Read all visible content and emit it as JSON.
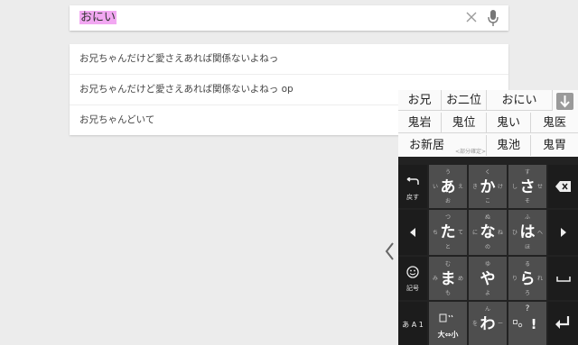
{
  "search": {
    "query": "おにい"
  },
  "suggestions": [
    "お兄ちゃんだけど愛さえあれば関係ないよねっ",
    "お兄ちゃんだけど愛さえあれば関係ないよねっ op",
    "お兄ちゃんどいて"
  ],
  "candidates": {
    "row1": [
      "お兄",
      "お二位",
      "おにい"
    ],
    "row2": [
      "鬼岩",
      "鬼位",
      "鬼い",
      "鬼医"
    ],
    "row3": [
      "お新居",
      "鬼池",
      "鬼胃"
    ],
    "partial_label": "<部分確定>"
  },
  "keyboard": {
    "undo_label": "戻す",
    "kigou_label": "記号",
    "mode_label": "あ A 1",
    "kana": [
      {
        "main": "あ",
        "top": "う",
        "left": "い",
        "right": "え",
        "bottom": "お"
      },
      {
        "main": "か",
        "top": "く",
        "left": "き",
        "right": "け",
        "bottom": "こ"
      },
      {
        "main": "さ",
        "top": "す",
        "left": "し",
        "right": "せ",
        "bottom": "そ"
      },
      {
        "main": "た",
        "top": "つ",
        "left": "ち",
        "right": "て",
        "bottom": "と"
      },
      {
        "main": "な",
        "top": "ぬ",
        "left": "に",
        "right": "ね",
        "bottom": "の"
      },
      {
        "main": "は",
        "top": "ふ",
        "left": "ひ",
        "right": "へ",
        "bottom": "ほ"
      },
      {
        "main": "ま",
        "top": "む",
        "left": "み",
        "right": "め",
        "bottom": "も"
      },
      {
        "main": "や",
        "top": "ゆ",
        "left": "",
        "right": "",
        "bottom": "よ"
      },
      {
        "main": "ら",
        "top": "る",
        "left": "り",
        "right": "れ",
        "bottom": "ろ"
      },
      {
        "main": "大⇔小",
        "top": "",
        "left": "",
        "right": "",
        "bottom": ""
      },
      {
        "main": "わ",
        "top": "ん",
        "left": "を",
        "right": "ー",
        "bottom": ""
      },
      {
        "main": "!",
        "top": "?",
        "left": "",
        "right": "",
        "bottom": ""
      }
    ]
  }
}
